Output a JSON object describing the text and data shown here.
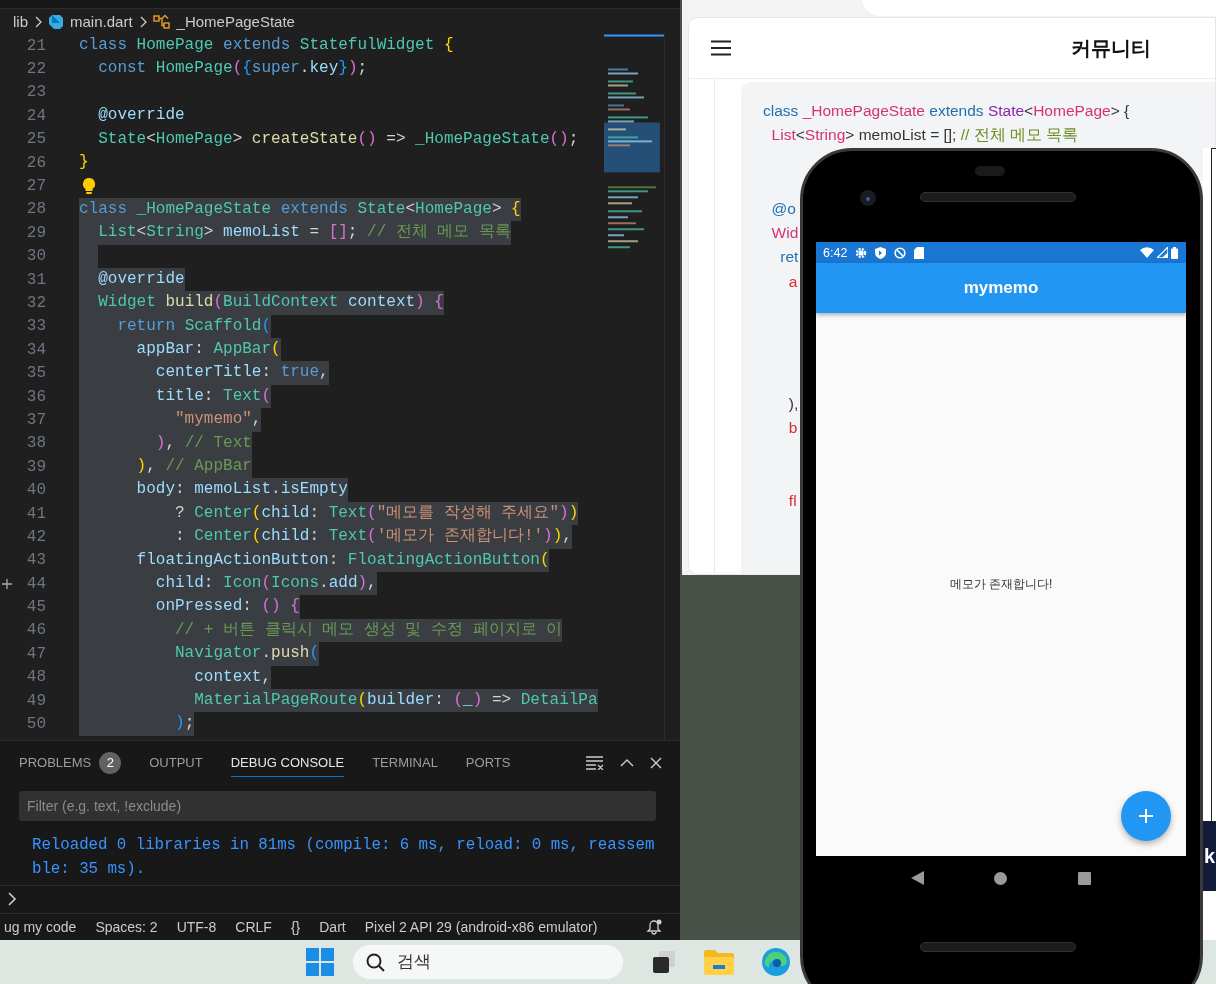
{
  "vscode": {
    "breadcrumb": [
      "lib",
      "main.dart",
      "_HomePageState"
    ],
    "editor": {
      "lines": [
        {
          "number": "21",
          "selected": false,
          "tokens": [
            {
              "kind": "kw",
              "text": "class "
            },
            {
              "kind": "type",
              "text": "HomePage "
            },
            {
              "kind": "kw",
              "text": "extends "
            },
            {
              "kind": "type",
              "text": "StatefulWidget "
            },
            {
              "kind": "b1",
              "text": "{"
            }
          ]
        },
        {
          "number": "22",
          "selected": false,
          "tokens": [
            {
              "kind": "kw",
              "text": "  const "
            },
            {
              "kind": "type",
              "text": "HomePage"
            },
            {
              "kind": "b2",
              "text": "("
            },
            {
              "kind": "b3",
              "text": "{"
            },
            {
              "kind": "kw",
              "text": "super"
            },
            {
              "kind": "pun",
              "text": "."
            },
            {
              "kind": "var",
              "text": "key"
            },
            {
              "kind": "b3",
              "text": "}"
            },
            {
              "kind": "b2",
              "text": ")"
            },
            {
              "kind": "pun",
              "text": ";"
            }
          ]
        },
        {
          "number": "23",
          "selected": false
        },
        {
          "number": "24",
          "selected": false,
          "tokens": [
            {
              "kind": "var",
              "text": "  @override"
            }
          ]
        },
        {
          "number": "25",
          "selected": false,
          "tokens": [
            {
              "kind": "type",
              "text": "  State"
            },
            {
              "kind": "pun",
              "text": "<"
            },
            {
              "kind": "type",
              "text": "HomePage"
            },
            {
              "kind": "pun",
              "text": "> "
            },
            {
              "kind": "fn",
              "text": "createState"
            },
            {
              "kind": "b2",
              "text": "()"
            },
            {
              "kind": "pun",
              "text": " => "
            },
            {
              "kind": "type",
              "text": "_HomePageState"
            },
            {
              "kind": "b2",
              "text": "()"
            },
            {
              "kind": "pun",
              "text": ";"
            }
          ]
        },
        {
          "number": "26",
          "selected": false,
          "tokens": [
            {
              "kind": "b1",
              "text": "}"
            }
          ]
        },
        {
          "number": "27",
          "selected": false,
          "lightbulb": true
        },
        {
          "number": "28",
          "selected": true,
          "tokens": [
            {
              "kind": "kw",
              "text": "class "
            },
            {
              "kind": "type",
              "text": "_HomePageState "
            },
            {
              "kind": "kw",
              "text": "extends "
            },
            {
              "kind": "type",
              "text": "State"
            },
            {
              "kind": "pun",
              "text": "<"
            },
            {
              "kind": "type",
              "text": "HomePage"
            },
            {
              "kind": "pun",
              "text": "> "
            },
            {
              "kind": "b1",
              "text": "{"
            }
          ]
        },
        {
          "number": "29",
          "selected": true,
          "tokens": [
            {
              "kind": "type",
              "text": "  List"
            },
            {
              "kind": "pun",
              "text": "<"
            },
            {
              "kind": "type",
              "text": "String"
            },
            {
              "kind": "pun",
              "text": "> "
            },
            {
              "kind": "var",
              "text": "memoList "
            },
            {
              "kind": "pun",
              "text": "= "
            },
            {
              "kind": "b2",
              "text": "[]"
            },
            {
              "kind": "pun",
              "text": "; "
            },
            {
              "kind": "com",
              "text": "// 전체 메모 목록"
            }
          ]
        },
        {
          "number": "30",
          "selected": true
        },
        {
          "number": "31",
          "selected": true,
          "tokens": [
            {
              "kind": "var",
              "text": "  @override"
            }
          ]
        },
        {
          "number": "32",
          "selected": true,
          "tokens": [
            {
              "kind": "type",
              "text": "  Widget "
            },
            {
              "kind": "fn",
              "text": "build"
            },
            {
              "kind": "b2",
              "text": "("
            },
            {
              "kind": "type",
              "text": "BuildContext "
            },
            {
              "kind": "var",
              "text": "context"
            },
            {
              "kind": "b2",
              "text": ") {"
            }
          ]
        },
        {
          "number": "33",
          "selected": true,
          "tokens": [
            {
              "kind": "kw",
              "text": "    return "
            },
            {
              "kind": "type",
              "text": "Scaffold"
            },
            {
              "kind": "b3",
              "text": "("
            }
          ]
        },
        {
          "number": "34",
          "selected": true,
          "tokens": [
            {
              "kind": "var",
              "text": "      appBar"
            },
            {
              "kind": "pun",
              "text": ": "
            },
            {
              "kind": "type",
              "text": "AppBar"
            },
            {
              "kind": "b1",
              "text": "("
            }
          ]
        },
        {
          "number": "35",
          "selected": true,
          "tokens": [
            {
              "kind": "var",
              "text": "        centerTitle"
            },
            {
              "kind": "pun",
              "text": ": "
            },
            {
              "kind": "kw",
              "text": "true"
            },
            {
              "kind": "pun",
              "text": ","
            }
          ]
        },
        {
          "number": "36",
          "selected": true,
          "tokens": [
            {
              "kind": "var",
              "text": "        title"
            },
            {
              "kind": "pun",
              "text": ": "
            },
            {
              "kind": "type",
              "text": "Text"
            },
            {
              "kind": "b2",
              "text": "("
            }
          ]
        },
        {
          "number": "37",
          "selected": true,
          "tokens": [
            {
              "kind": "str",
              "text": "          \"mymemo\""
            },
            {
              "kind": "pun",
              "text": ","
            }
          ]
        },
        {
          "number": "38",
          "selected": true,
          "tokens": [
            {
              "kind": "b2",
              "text": "        )"
            },
            {
              "kind": "pun",
              "text": ", "
            },
            {
              "kind": "com",
              "text": "// Text"
            }
          ]
        },
        {
          "number": "39",
          "selected": true,
          "tokens": [
            {
              "kind": "b1",
              "text": "      )"
            },
            {
              "kind": "pun",
              "text": ", "
            },
            {
              "kind": "com",
              "text": "// AppBar"
            }
          ]
        },
        {
          "number": "40",
          "selected": true,
          "tokens": [
            {
              "kind": "var",
              "text": "      body"
            },
            {
              "kind": "pun",
              "text": ": "
            },
            {
              "kind": "var",
              "text": "memoList"
            },
            {
              "kind": "pun",
              "text": "."
            },
            {
              "kind": "var",
              "text": "isEmpty"
            }
          ]
        },
        {
          "number": "41",
          "selected": true,
          "tokens": [
            {
              "kind": "pun",
              "text": "          ? "
            },
            {
              "kind": "type",
              "text": "Center"
            },
            {
              "kind": "b1",
              "text": "("
            },
            {
              "kind": "var",
              "text": "child"
            },
            {
              "kind": "pun",
              "text": ": "
            },
            {
              "kind": "type",
              "text": "Text"
            },
            {
              "kind": "b2",
              "text": "("
            },
            {
              "kind": "str",
              "text": "\"메모를 작성해 주세요\""
            },
            {
              "kind": "b2",
              "text": ")"
            },
            {
              "kind": "b1",
              "text": ")"
            }
          ]
        },
        {
          "number": "42",
          "selected": true,
          "tokens": [
            {
              "kind": "pun",
              "text": "          : "
            },
            {
              "kind": "type",
              "text": "Center"
            },
            {
              "kind": "b1",
              "text": "("
            },
            {
              "kind": "var",
              "text": "child"
            },
            {
              "kind": "pun",
              "text": ": "
            },
            {
              "kind": "type",
              "text": "Text"
            },
            {
              "kind": "b2",
              "text": "("
            },
            {
              "kind": "str",
              "text": "'메모가 존재합니다!'"
            },
            {
              "kind": "b2",
              "text": ")"
            },
            {
              "kind": "b1",
              "text": ")"
            },
            {
              "kind": "pun",
              "text": ","
            }
          ]
        },
        {
          "number": "43",
          "selected": true,
          "tokens": [
            {
              "kind": "var",
              "text": "      floatingActionButton"
            },
            {
              "kind": "pun",
              "text": ": "
            },
            {
              "kind": "type",
              "text": "FloatingActionButton"
            },
            {
              "kind": "b1",
              "text": "("
            }
          ]
        },
        {
          "number": "44",
          "selected": true,
          "change_marker": true,
          "tokens": [
            {
              "kind": "var",
              "text": "        child"
            },
            {
              "kind": "pun",
              "text": ": "
            },
            {
              "kind": "type",
              "text": "Icon"
            },
            {
              "kind": "b2",
              "text": "("
            },
            {
              "kind": "type",
              "text": "Icons"
            },
            {
              "kind": "pun",
              "text": "."
            },
            {
              "kind": "var",
              "text": "add"
            },
            {
              "kind": "b2",
              "text": ")"
            },
            {
              "kind": "pun",
              "text": ","
            }
          ]
        },
        {
          "number": "45",
          "selected": true,
          "tokens": [
            {
              "kind": "var",
              "text": "        onPressed"
            },
            {
              "kind": "pun",
              "text": ": "
            },
            {
              "kind": "b2",
              "text": "() {"
            }
          ]
        },
        {
          "number": "46",
          "selected": true,
          "tokens": [
            {
              "kind": "com",
              "text": "          // + 버튼 클릭시 메모 생성 및 수정 페이지로 이"
            }
          ]
        },
        {
          "number": "47",
          "selected": true,
          "tokens": [
            {
              "kind": "type",
              "text": "          Navigator"
            },
            {
              "kind": "pun",
              "text": "."
            },
            {
              "kind": "fn",
              "text": "push"
            },
            {
              "kind": "b3",
              "text": "("
            }
          ]
        },
        {
          "number": "48",
          "selected": true,
          "tokens": [
            {
              "kind": "var",
              "text": "            context"
            },
            {
              "kind": "pun",
              "text": ","
            }
          ]
        },
        {
          "number": "49",
          "selected": true,
          "tokens": [
            {
              "kind": "type",
              "text": "            MaterialPageRoute"
            },
            {
              "kind": "b1",
              "text": "("
            },
            {
              "kind": "var",
              "text": "builder"
            },
            {
              "kind": "pun",
              "text": ": "
            },
            {
              "kind": "b2",
              "text": "("
            },
            {
              "kind": "var",
              "text": "_"
            },
            {
              "kind": "b2",
              "text": ")"
            },
            {
              "kind": "pun",
              "text": " => "
            },
            {
              "kind": "type",
              "text": "DetailPa"
            }
          ]
        },
        {
          "number": "50",
          "selected": true,
          "tokens": [
            {
              "kind": "b3",
              "text": "          )"
            },
            {
              "kind": "pun",
              "text": ";"
            }
          ]
        }
      ]
    },
    "panel": {
      "tabs": [
        {
          "label": "PROBLEMS",
          "badge": "2",
          "selected": false
        },
        {
          "label": "OUTPUT",
          "selected": false
        },
        {
          "label": "DEBUG CONSOLE",
          "selected": true
        },
        {
          "label": "TERMINAL",
          "selected": false
        },
        {
          "label": "PORTS",
          "selected": false
        }
      ],
      "filter": {
        "placeholder": "Filter (e.g. text, !exclude)"
      },
      "output": "Reloaded 0 libraries in 81ms (compile: 6 ms, reload: 0 ms, reassemble: 35 ms)."
    },
    "status_bar": [
      "ug my code",
      "Spaces: 2",
      "UTF-8",
      "CRLF",
      "{}",
      "Dart",
      "Pixel 2 API 29 (android-x86 emulator)"
    ]
  },
  "browser": {
    "title": "커뮤니티",
    "code_lines": [
      {
        "tokens": [
          {
            "kind": "kw",
            "text": "class "
          },
          {
            "kind": "type",
            "text": "_HomePageState "
          },
          {
            "kind": "kw",
            "text": "extends "
          },
          {
            "kind": "cls",
            "text": "State"
          },
          {
            "kind": "pun",
            "text": "<"
          },
          {
            "kind": "type",
            "text": "HomePage"
          },
          {
            "kind": "pun",
            "text": "> {"
          }
        ]
      },
      {
        "tokens": [
          {
            "kind": "type",
            "text": "  List"
          },
          {
            "kind": "pun",
            "text": "<"
          },
          {
            "kind": "type",
            "text": "String"
          },
          {
            "kind": "pun",
            "text": "> memoList = []; "
          },
          {
            "kind": "com",
            "text": "// 전체 메모 목록"
          }
        ]
      },
      {
        "tokens": [
          {
            "kind": "kw",
            "text": "  @o"
          }
        ]
      },
      {
        "tokens": [
          {
            "kind": "type",
            "text": "  Wid"
          }
        ]
      },
      {
        "tokens": [
          {
            "kind": "kw",
            "text": "    ret"
          }
        ]
      },
      {
        "tokens": [
          {
            "kind": "var",
            "text": "      a"
          }
        ]
      },
      {
        "tokens": [
          {
            "kind": "pun",
            "text": "      ),"
          }
        ]
      },
      {
        "tokens": [
          {
            "kind": "var",
            "text": "      b"
          }
        ]
      },
      {
        "tokens": [
          {
            "kind": "var",
            "text": "      fl"
          }
        ]
      }
    ]
  },
  "emulator": {
    "time": "6:42",
    "app_title": "mymemo",
    "body_text": "메모가 존재합니다!"
  },
  "side_fragment": "k",
  "taskbar": {
    "search_placeholder": "검색"
  }
}
